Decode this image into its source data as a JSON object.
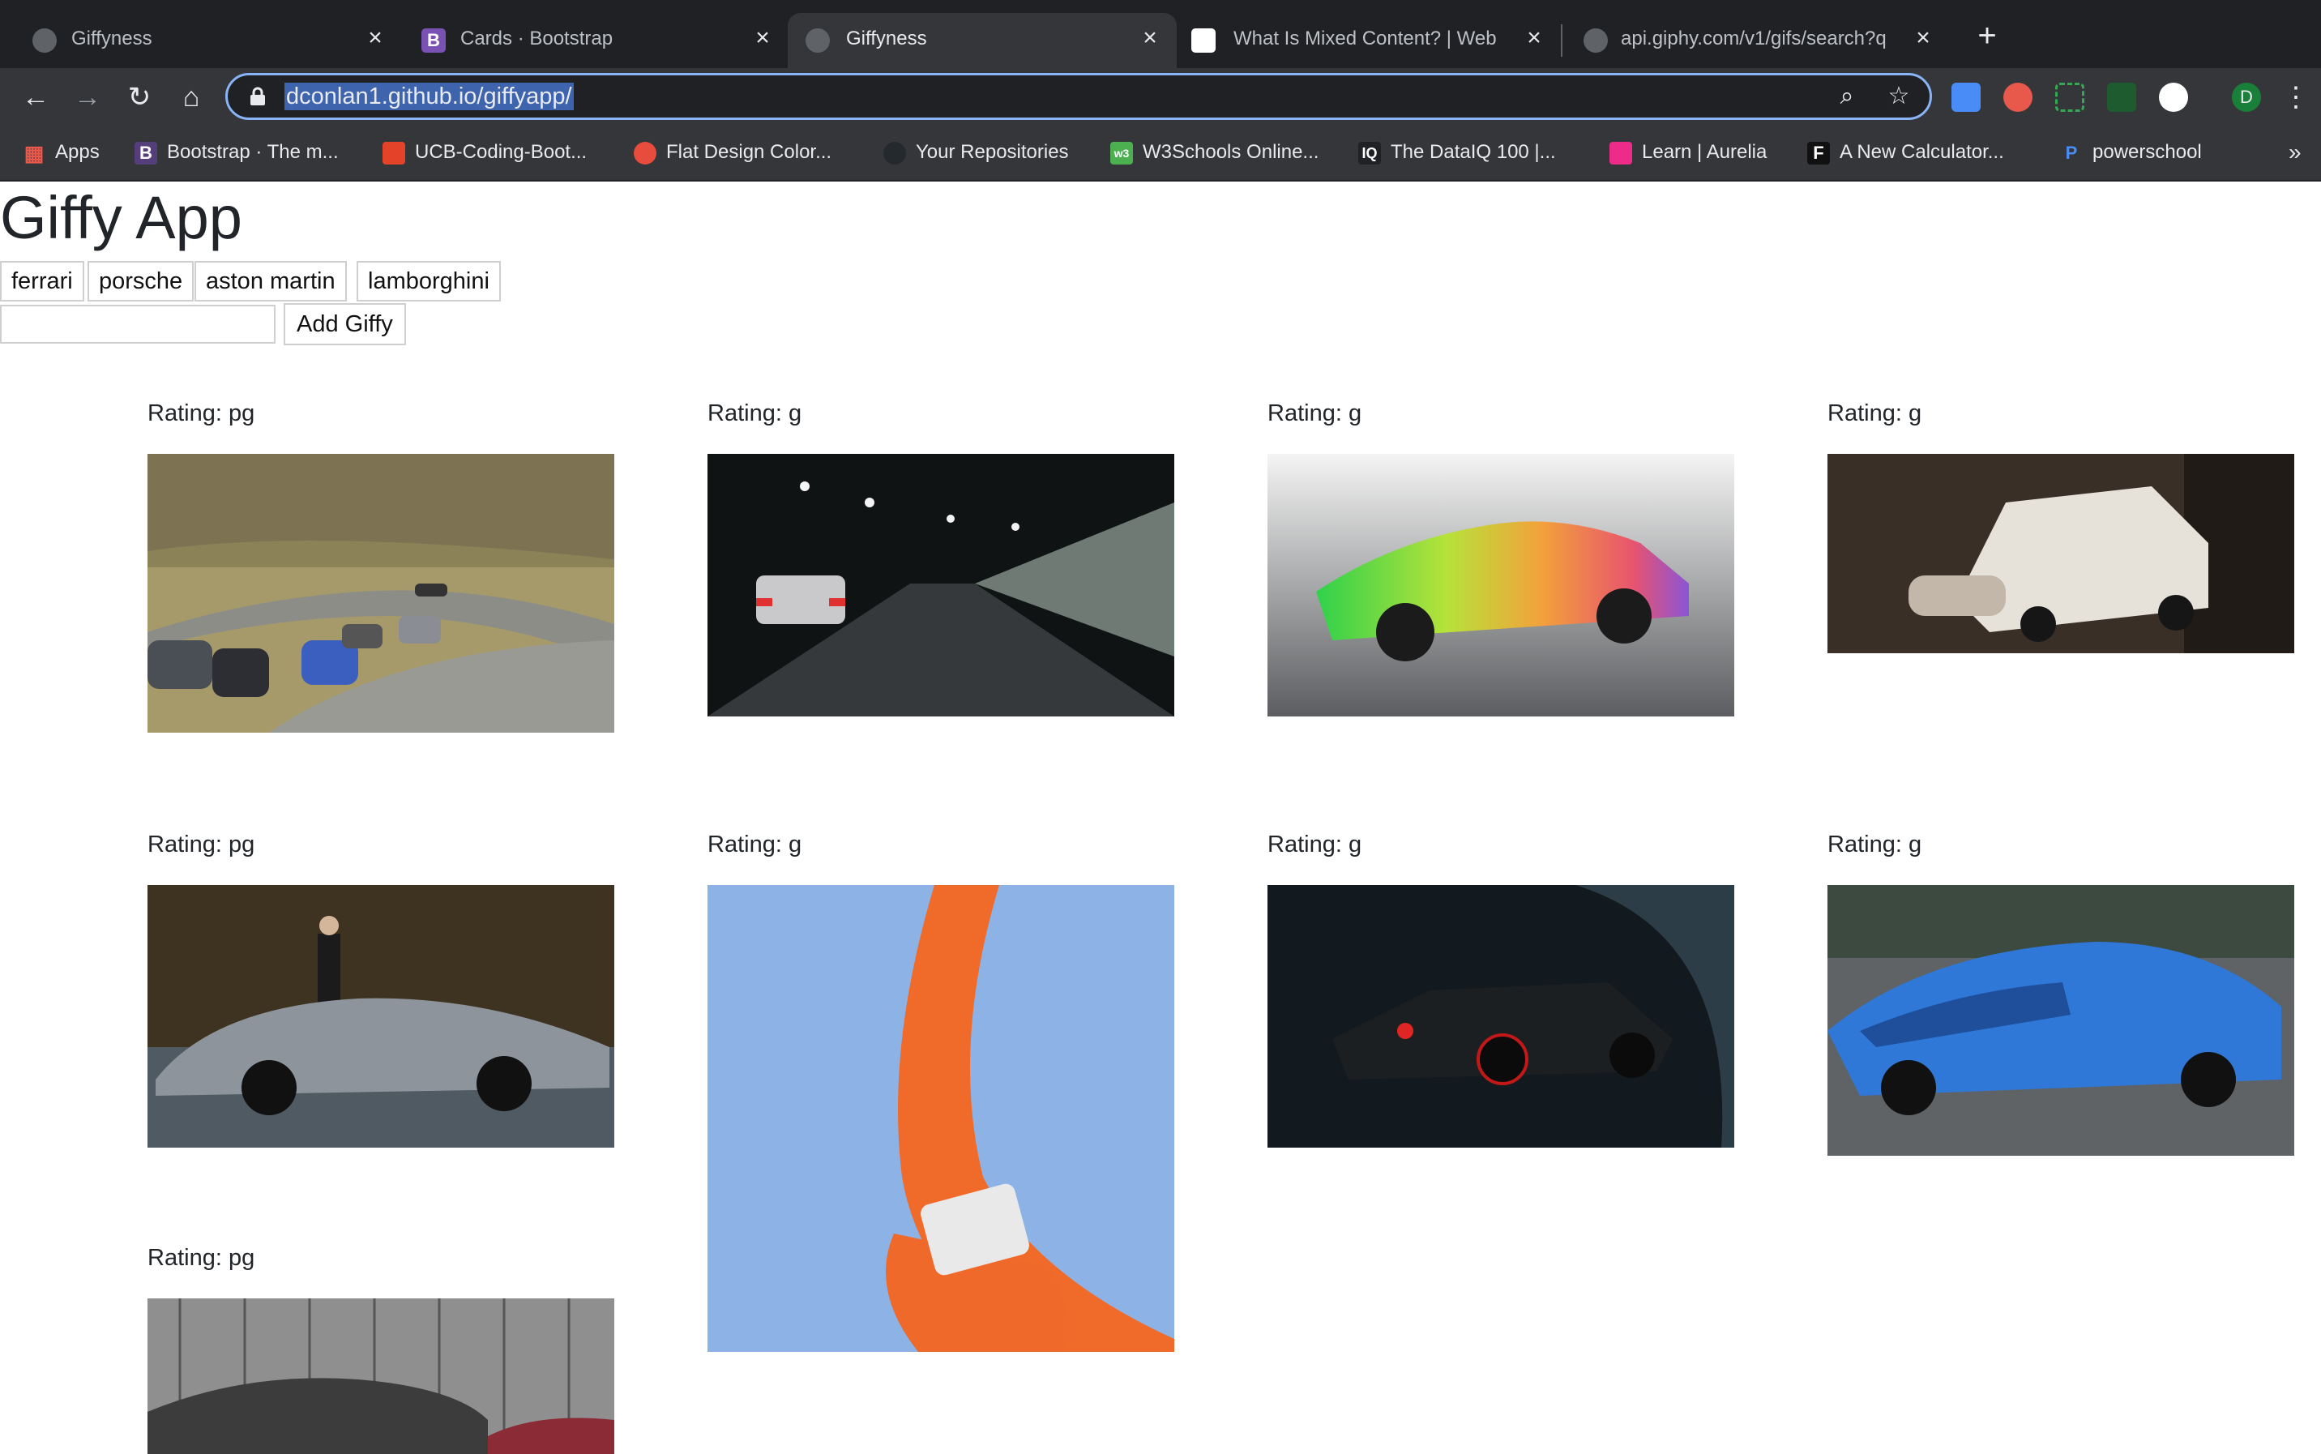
{
  "tabs": [
    {
      "title": "Giffyness",
      "active": false
    },
    {
      "title": "Cards · Bootstrap",
      "active": false
    },
    {
      "title": "Giffyness",
      "active": true
    },
    {
      "title": "What Is Mixed Content? | Web",
      "active": false
    },
    {
      "title": "api.giphy.com/v1/gifs/search?q",
      "active": false
    }
  ],
  "address_bar": {
    "url": "dconlan1.github.io/giffyapp/"
  },
  "profile": {
    "initial": "D"
  },
  "bookmarks": [
    {
      "label": "Apps",
      "icon": "apps-grid-icon"
    },
    {
      "label": "Bootstrap · The m...",
      "icon": "bootstrap-icon"
    },
    {
      "label": "UCB-Coding-Boot...",
      "icon": "gitlab-icon"
    },
    {
      "label": "Flat Design Color...",
      "icon": "flat-design-icon"
    },
    {
      "label": "Your Repositories",
      "icon": "github-icon"
    },
    {
      "label": "W3Schools Online...",
      "icon": "w3schools-icon"
    },
    {
      "label": "The DataIQ 100 |...",
      "icon": "dataiq-icon"
    },
    {
      "label": "Learn | Aurelia",
      "icon": "aurelia-icon"
    },
    {
      "label": "A New Calculator...",
      "icon": "f-icon"
    },
    {
      "label": "powerschool",
      "icon": "powerschool-icon"
    }
  ],
  "bookmarks_overflow": "»",
  "app": {
    "title": "Giffy App",
    "topics": [
      "ferrari",
      "porsche",
      "aston martin",
      "lamborghini"
    ],
    "add_button": "Add Giffy",
    "input_value": ""
  },
  "gifs": [
    {
      "rating": "Rating: pg",
      "scene": "mountain-road-cars"
    },
    {
      "rating": "Rating: g",
      "scene": "night-tunnel-drive"
    },
    {
      "rating": "Rating: g",
      "scene": "rainbow-lamborghini"
    },
    {
      "rating": "Rating: g",
      "scene": "white-countach"
    },
    {
      "rating": "Rating: pg",
      "scene": "veneno-show"
    },
    {
      "rating": "Rating: g",
      "scene": "hot-wheels-track"
    },
    {
      "rating": "Rating: g",
      "scene": "dark-lamborghini"
    },
    {
      "rating": "Rating: g",
      "scene": "blue-huracan"
    },
    {
      "rating": "Rating: pg",
      "scene": "street-crash"
    }
  ]
}
